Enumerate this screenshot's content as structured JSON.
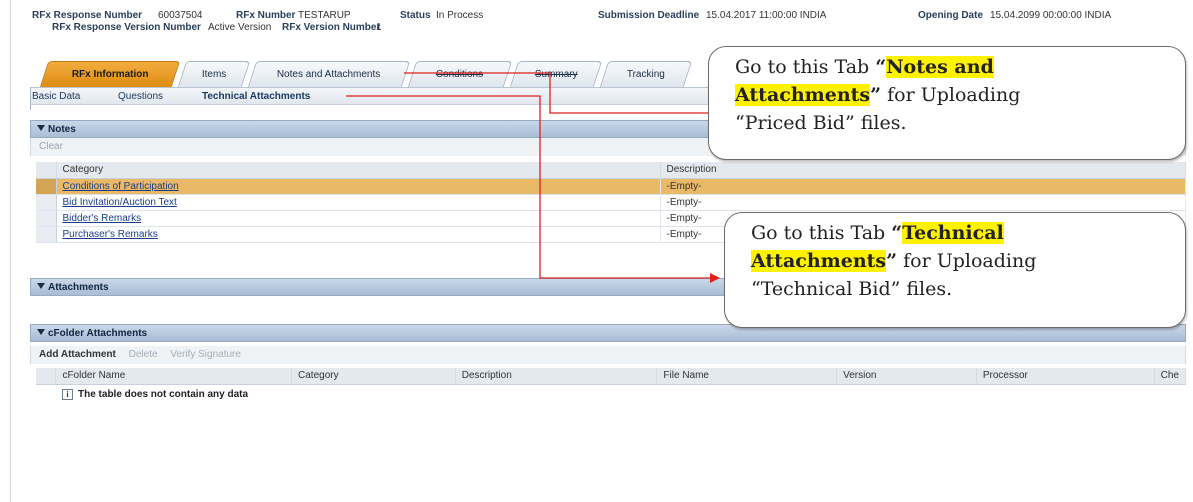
{
  "header": {
    "response_number_label": "RFx Response Number",
    "response_number": "60037504",
    "rfx_number_label": "RFx Number",
    "rfx_number": "TESTARUP",
    "status_label": "Status",
    "status": "In Process",
    "deadline_label": "Submission Deadline",
    "deadline": "15.04.2017 11:00:00 INDIA",
    "opening_label": "Opening Date",
    "opening": "15.04.2099 00:00:00 INDIA",
    "response_version_label": "RFx Response Version Number",
    "response_version": "Active Version",
    "rfx_version_label": "RFx Version Number",
    "rfx_version": "1"
  },
  "tabs": [
    {
      "label": "RFx Information",
      "active": true
    },
    {
      "label": "Items"
    },
    {
      "label": "Notes and Attachments"
    },
    {
      "label": "Conditions"
    },
    {
      "label": "Summary"
    },
    {
      "label": "Tracking"
    }
  ],
  "subtabs": [
    "Basic Data",
    "Questions",
    "Technical Attachments"
  ],
  "notes": {
    "title": "Notes",
    "toolbar": "Clear",
    "columns": [
      "Category",
      "Description"
    ],
    "rows": [
      {
        "category": "Conditions of Participation",
        "description": "-Empty-"
      },
      {
        "category": "Bid Invitation/Auction Text",
        "description": "-Empty-"
      },
      {
        "category": "Bidder's Remarks",
        "description": "-Empty-"
      },
      {
        "category": "Purchaser's Remarks",
        "description": "-Empty-"
      }
    ]
  },
  "attachments": {
    "title": "Attachments"
  },
  "cfolder": {
    "title": "cFolder Attachments",
    "toolbar": {
      "add": "Add Attachment",
      "delete": "Delete",
      "verify": "Verify Signature"
    },
    "columns": [
      "cFolder Name",
      "Category",
      "Description",
      "File Name",
      "Version",
      "Processor",
      "Che"
    ],
    "empty": "The table does not contain any data"
  },
  "callouts": {
    "notes": {
      "pre": "Go to this Tab ",
      "open_quote": "“",
      "hl1": "Notes and",
      "hl2": "Attachments",
      "close_quote": "”",
      "post": " for Uploading",
      "line3": "“Priced Bid” files."
    },
    "technical": {
      "pre": "Go to this Tab ",
      "open_quote": "“",
      "hl1": "Technical",
      "hl2": "Attachments",
      "close_quote": "”",
      "post": " for Uploading",
      "line3": "“Technical Bid” files."
    }
  },
  "colors": {
    "active_tab": "#de8b11",
    "arrow": "#e0201b",
    "highlight": "#fff200",
    "row_highlight": "#e9b967"
  }
}
